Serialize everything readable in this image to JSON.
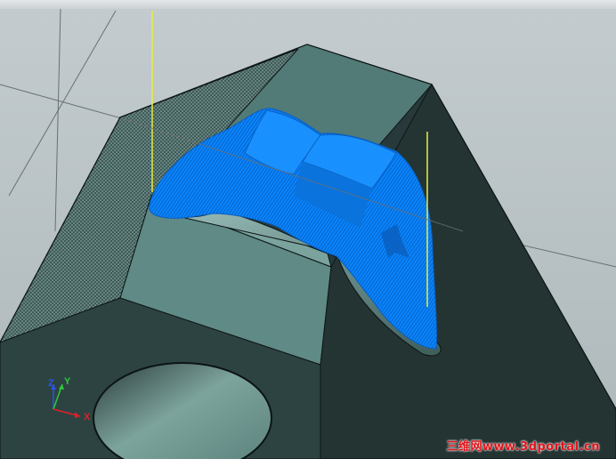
{
  "viewport": {
    "background_color": "#b7c0c3",
    "gridline_color": "#6a6f72",
    "tool_axis_color": "#e9ee3c"
  },
  "model": {
    "body_color": "#27393a",
    "face_light_color": "#5f8a86",
    "face_mid_color": "#4a716d",
    "face_dark_color": "#2b3d3d",
    "hatched_face_color": "#3d5a58",
    "toolpath_color": "#0a87ff",
    "toolpath_highlight_color": "#5fb7ff",
    "bore_color": "#6f958f"
  },
  "axis_triad": {
    "x_label": "X",
    "y_label": "Y",
    "z_label": "Z",
    "x_color": "#e21f26",
    "y_color": "#2ecb3a",
    "z_color": "#2a55e6"
  },
  "watermark": {
    "text": "三维网www.3dportal.cn",
    "color": "#e2141b"
  }
}
